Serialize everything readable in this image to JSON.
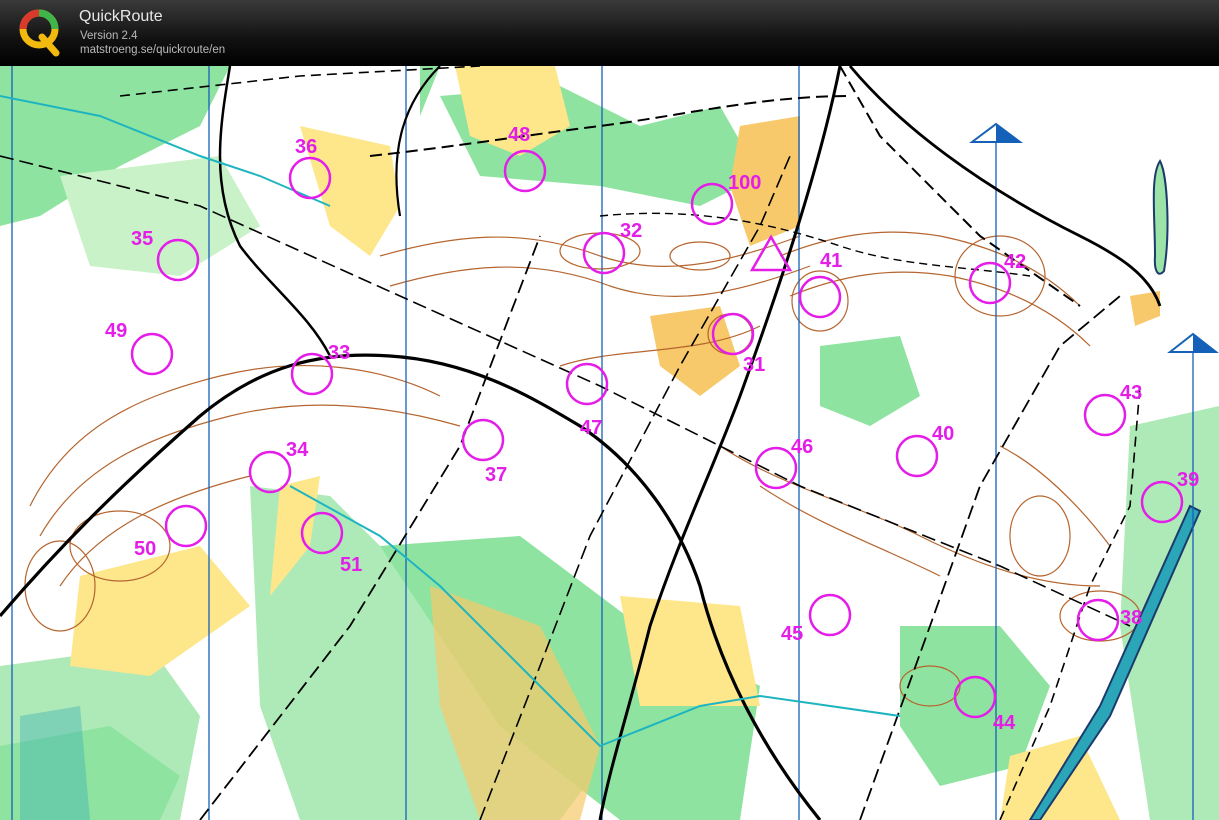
{
  "app": {
    "name": "QuickRoute",
    "version": "Version 2.4",
    "url": "matstroeng.se/quickroute/en",
    "logo_icon": "quickroute-logo-q-icon"
  },
  "colors": {
    "titlebar": "#111111",
    "control": "#e41ee8",
    "vegetation_green": "#8fe3a0",
    "open_yellow": "#f7c96a",
    "contour_brown": "#b5652f",
    "north_line": "#1560b8",
    "water": "#2aa6b8"
  },
  "map": {
    "controls": [
      {
        "label": "36"
      },
      {
        "label": "48"
      },
      {
        "label": "100"
      },
      {
        "label": "35"
      },
      {
        "label": "32"
      },
      {
        "label": "41"
      },
      {
        "label": "42"
      },
      {
        "label": "49"
      },
      {
        "label": "33"
      },
      {
        "label": "31"
      },
      {
        "label": "47"
      },
      {
        "label": "43"
      },
      {
        "label": "40"
      },
      {
        "label": "34"
      },
      {
        "label": "37"
      },
      {
        "label": "46"
      },
      {
        "label": "39"
      },
      {
        "label": "50"
      },
      {
        "label": "51"
      },
      {
        "label": "45"
      },
      {
        "label": "38"
      },
      {
        "label": "44"
      }
    ]
  }
}
